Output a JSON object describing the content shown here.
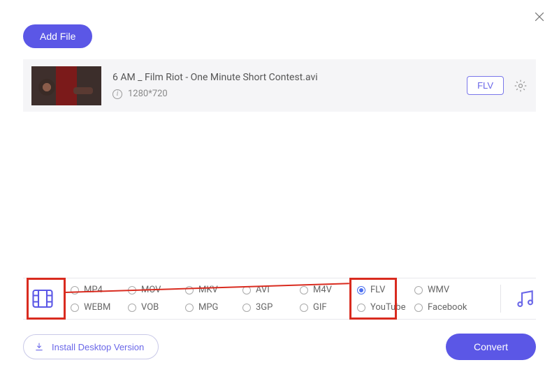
{
  "header": {
    "add_file": "Add File"
  },
  "file": {
    "title": "6 AM _ Film Riot - One Minute Short Contest.avi",
    "resolution": "1280*720",
    "format_badge": "FLV"
  },
  "formats": {
    "row1": [
      "MP4",
      "MOV",
      "MKV",
      "AVI",
      "M4V",
      "FLV",
      "WMV"
    ],
    "row2": [
      "WEBM",
      "VOB",
      "MPG",
      "3GP",
      "GIF",
      "YouTube",
      "Facebook"
    ],
    "selected": "FLV"
  },
  "footer": {
    "install": "Install Desktop Version",
    "convert": "Convert"
  }
}
